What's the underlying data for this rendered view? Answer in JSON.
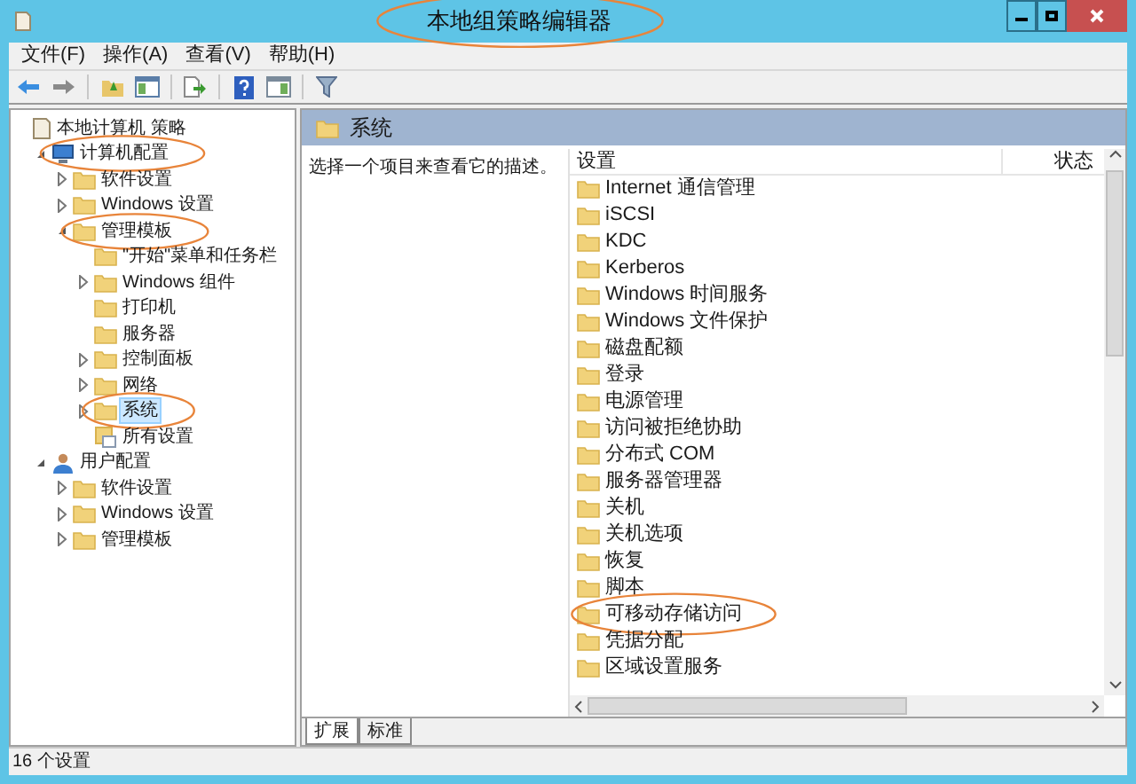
{
  "window": {
    "title": "本地组策略编辑器",
    "circled": true
  },
  "menu": [
    "文件(F)",
    "操作(A)",
    "查看(V)",
    "帮助(H)"
  ],
  "tree": [
    {
      "label": "本地计算机 策略",
      "kind": "policy",
      "expandable": false,
      "selected": false,
      "circled": false,
      "children": [
        {
          "label": "计算机配置",
          "kind": "computer",
          "expandable": true,
          "expanded": true,
          "selected": false,
          "circled": true,
          "children": [
            {
              "label": "软件设置",
              "kind": "folder",
              "expandable": true,
              "expanded": false,
              "selected": false,
              "circled": false
            },
            {
              "label": "Windows 设置",
              "kind": "folder",
              "expandable": true,
              "expanded": false,
              "selected": false,
              "circled": false
            },
            {
              "label": "管理模板",
              "kind": "folder",
              "expandable": true,
              "expanded": true,
              "selected": false,
              "circled": true,
              "children": [
                {
                  "label": "\"开始\"菜单和任务栏",
                  "kind": "folder",
                  "expandable": false,
                  "selected": false,
                  "circled": false
                },
                {
                  "label": "Windows 组件",
                  "kind": "folder",
                  "expandable": true,
                  "expanded": false,
                  "selected": false,
                  "circled": false
                },
                {
                  "label": "打印机",
                  "kind": "folder",
                  "expandable": false,
                  "selected": false,
                  "circled": false
                },
                {
                  "label": "服务器",
                  "kind": "folder",
                  "expandable": false,
                  "selected": false,
                  "circled": false
                },
                {
                  "label": "控制面板",
                  "kind": "folder",
                  "expandable": true,
                  "expanded": false,
                  "selected": false,
                  "circled": false
                },
                {
                  "label": "网络",
                  "kind": "folder",
                  "expandable": true,
                  "expanded": false,
                  "selected": false,
                  "circled": false
                },
                {
                  "label": "系统",
                  "kind": "folder",
                  "expandable": true,
                  "expanded": false,
                  "selected": true,
                  "circled": true
                },
                {
                  "label": "所有设置",
                  "kind": "all",
                  "expandable": false,
                  "selected": false,
                  "circled": false
                }
              ]
            }
          ]
        },
        {
          "label": "用户配置",
          "kind": "user",
          "expandable": true,
          "expanded": true,
          "selected": false,
          "circled": false,
          "children": [
            {
              "label": "软件设置",
              "kind": "folder",
              "expandable": true,
              "expanded": false,
              "selected": false,
              "circled": false
            },
            {
              "label": "Windows 设置",
              "kind": "folder",
              "expandable": true,
              "expanded": false,
              "selected": false,
              "circled": false
            },
            {
              "label": "管理模板",
              "kind": "folder",
              "expandable": true,
              "expanded": false,
              "selected": false,
              "circled": false
            }
          ]
        }
      ]
    }
  ],
  "pane": {
    "title": "系统",
    "description": "选择一个项目来查看它的描述。",
    "columns": [
      "设置",
      "状态"
    ],
    "items": [
      {
        "label": "Internet 通信管理",
        "circled": false
      },
      {
        "label": "iSCSI",
        "circled": false
      },
      {
        "label": "KDC",
        "circled": false
      },
      {
        "label": "Kerberos",
        "circled": false
      },
      {
        "label": "Windows 时间服务",
        "circled": false
      },
      {
        "label": "Windows 文件保护",
        "circled": false
      },
      {
        "label": "磁盘配额",
        "circled": false
      },
      {
        "label": "登录",
        "circled": false
      },
      {
        "label": "电源管理",
        "circled": false
      },
      {
        "label": "访问被拒绝协助",
        "circled": false
      },
      {
        "label": "分布式 COM",
        "circled": false
      },
      {
        "label": "服务器管理器",
        "circled": false
      },
      {
        "label": "关机",
        "circled": false
      },
      {
        "label": "关机选项",
        "circled": false
      },
      {
        "label": "恢复",
        "circled": false
      },
      {
        "label": "脚本",
        "circled": false
      },
      {
        "label": "可移动存储访问",
        "circled": true
      },
      {
        "label": "凭据分配",
        "circled": false
      },
      {
        "label": "区域设置服务",
        "circled": false
      }
    ],
    "tabs": [
      {
        "label": "扩展",
        "selected": true
      },
      {
        "label": "标准",
        "selected": false
      }
    ]
  },
  "status_bar": "16 个设置"
}
